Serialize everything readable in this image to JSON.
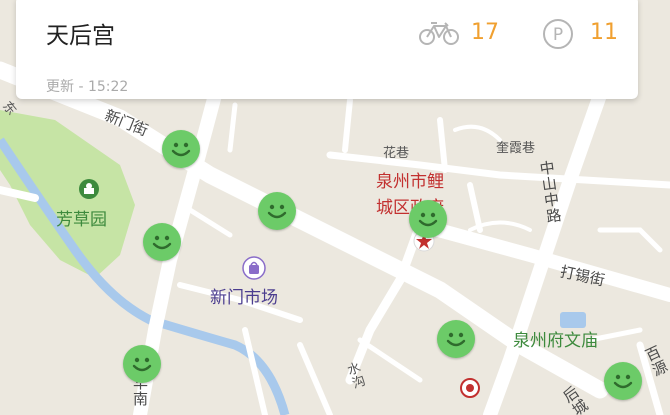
{
  "station": {
    "name": "天后宫",
    "bikes_available": "17",
    "parking_available": "11",
    "updated_prefix": "更新 - ",
    "updated_time": "15:22"
  },
  "map": {
    "road_labels": {
      "xinmen_street": "新门街",
      "huaxiang": "花巷",
      "kuixiaxiang": "奎霞巷",
      "zhongshan_road": "中山中路",
      "daxi_street": "打锡街",
      "road_left_edge": "东",
      "road_bottom_left": "华南",
      "road_bottom_mid": "水沟",
      "road_bottom_right": "后城",
      "road_right_edge": "百源"
    },
    "pois": {
      "fangcao_garden": "芳草园",
      "xinmen_market": "新门市场",
      "quanzhou_city_hall_line1": "泉州市鲤",
      "quanzhou_city_hall_line2": "城区政府",
      "confucian_temple": "泉州府文庙"
    },
    "colors": {
      "map_background": "#ece8df",
      "road": "#ffffff",
      "park": "#c6e4a5",
      "water": "#a8c9ec",
      "marker": "#6ccb68",
      "accent_orange": "#f0a030",
      "government_red": "#c2302f"
    },
    "markers_count_label": ""
  },
  "icons": {
    "bike": "bicycle-icon",
    "parking": "parking-icon",
    "marker": "smiley-station-icon",
    "park": "park-icon",
    "market": "shopping-bag-icon",
    "government": "star-pin-icon",
    "target": "target-icon"
  }
}
